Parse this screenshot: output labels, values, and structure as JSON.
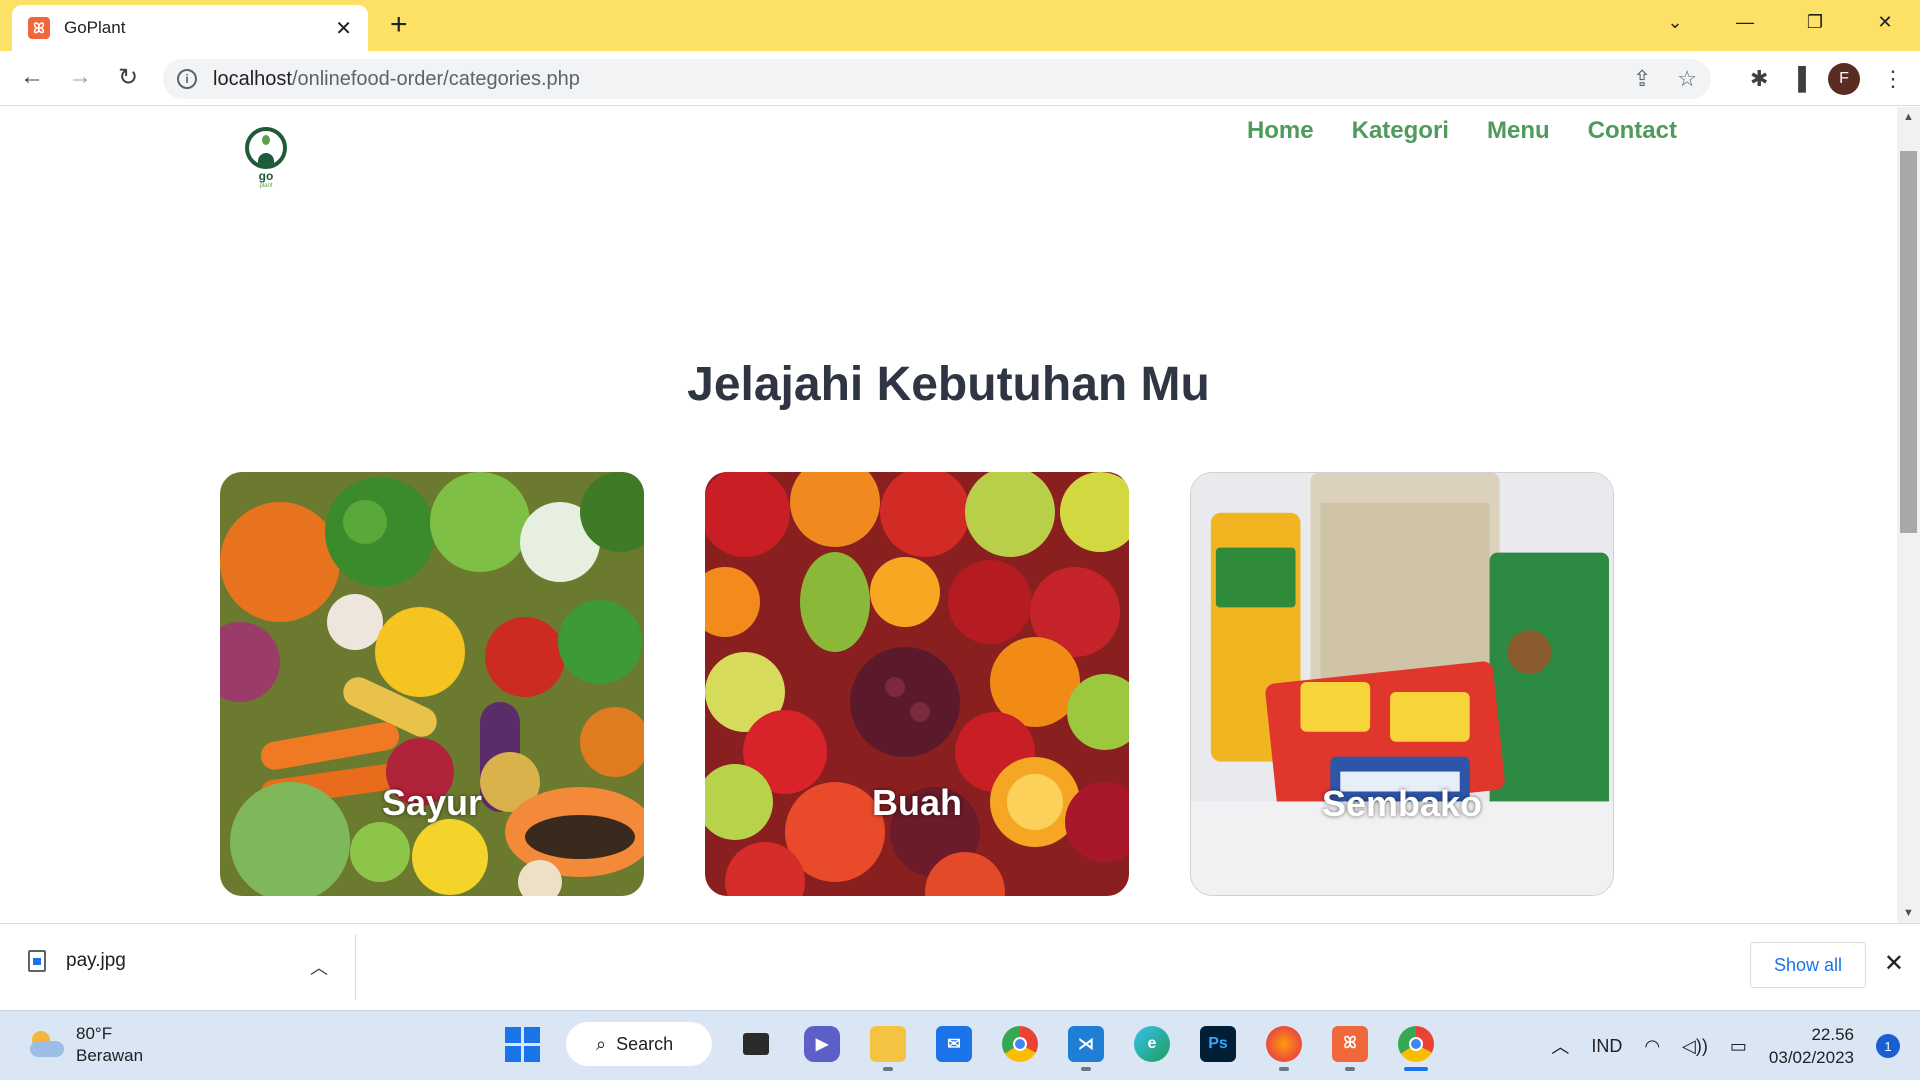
{
  "browser": {
    "tab_title": "GoPlant",
    "tab_close": "✕",
    "new_tab": "+",
    "url_host": "localhost",
    "url_path": "/onlinefood-order/categories.php",
    "profile_initial": "F",
    "accent_color": "#fde166"
  },
  "site": {
    "logo_text": "go",
    "logo_subtext": "plant",
    "nav": [
      {
        "label": "Home"
      },
      {
        "label": "Kategori"
      },
      {
        "label": "Menu"
      },
      {
        "label": "Contact"
      }
    ],
    "nav_color": "#4f9a5d",
    "heading": "Jelajahi Kebutuhan Mu",
    "categories": [
      {
        "label": "Sayur"
      },
      {
        "label": "Buah"
      },
      {
        "label": "Sembako"
      }
    ]
  },
  "downloads": {
    "file_name": "pay.jpg",
    "show_all": "Show all"
  },
  "taskbar": {
    "weather_temp": "80°F",
    "weather_cond": "Berawan",
    "search_label": "Search",
    "language": "IND",
    "time": "22.56",
    "date": "03/02/2023",
    "notification_count": "1"
  }
}
